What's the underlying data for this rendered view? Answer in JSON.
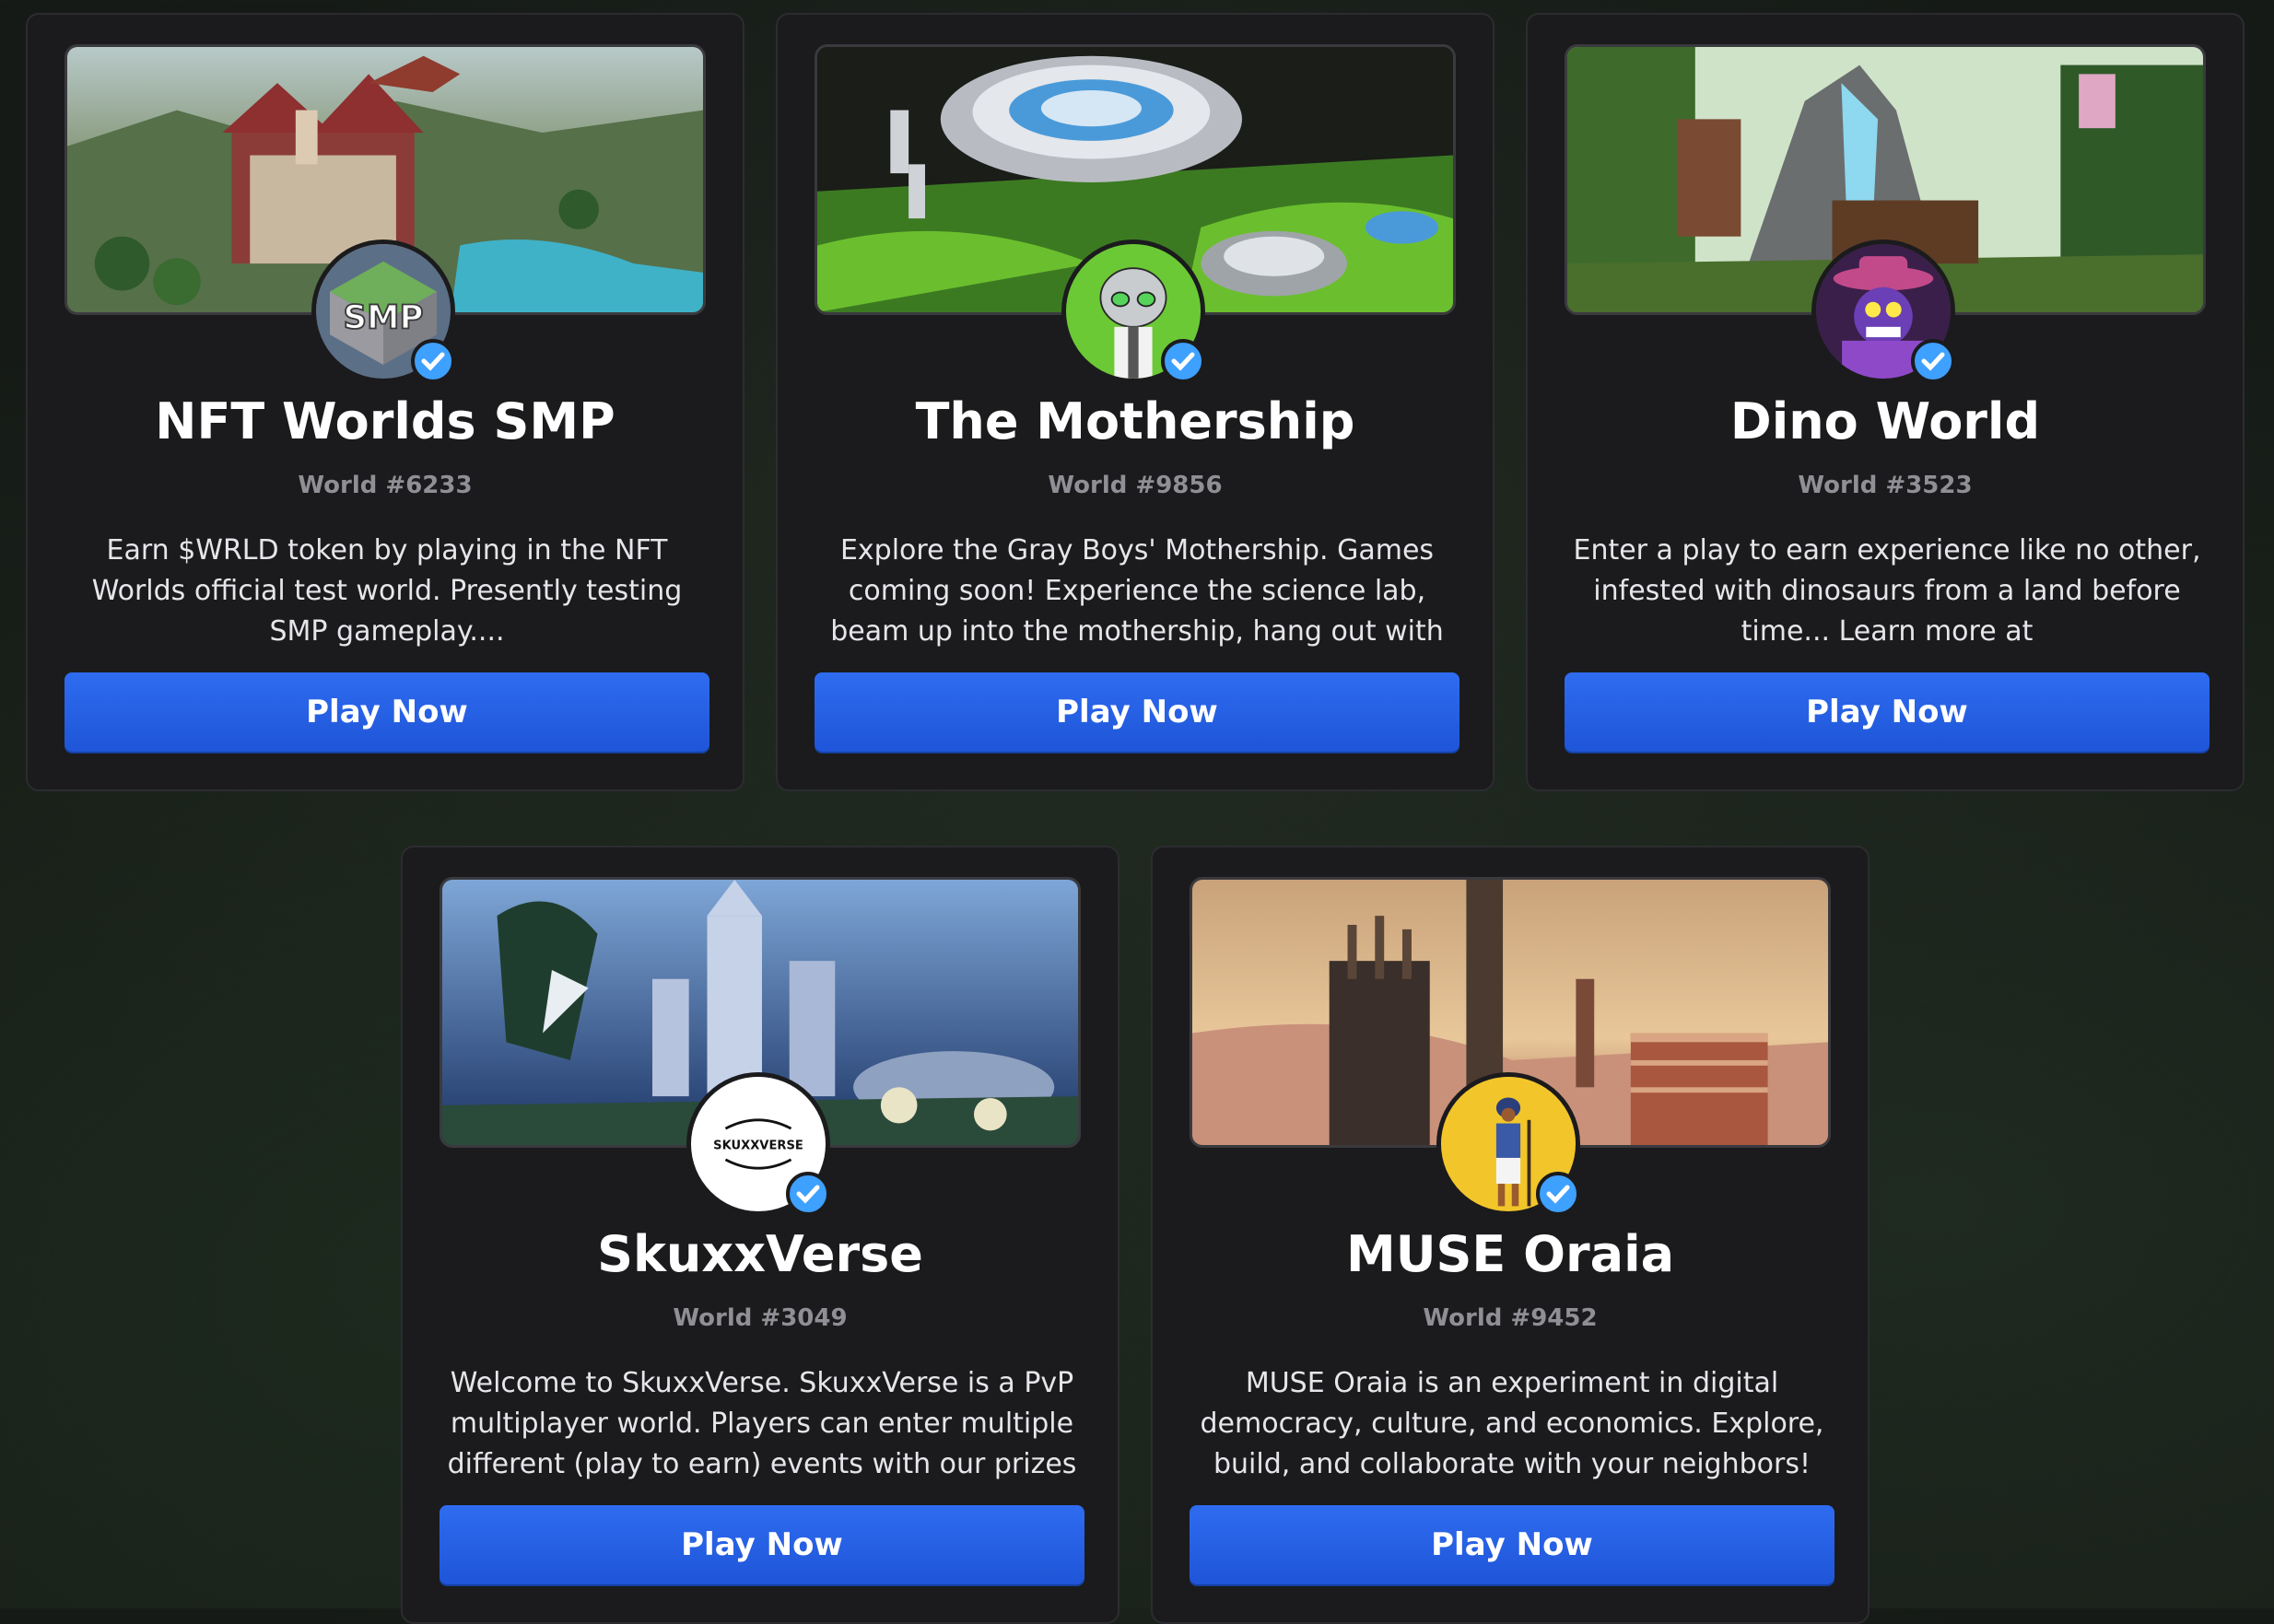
{
  "colors": {
    "card_bg": "#1b1b1d",
    "button_bg": "#2563eb",
    "button_text": "#ffffff",
    "title_text": "#ffffff",
    "subtitle_text": "#8f8f95",
    "verified_badge": "#3ea0ff"
  },
  "cards": [
    {
      "title": "NFT Worlds SMP",
      "world_id": "World #6233",
      "description": "Earn $WRLD token by playing in the NFT Worlds official test world. Presently testing SMP gameplay....",
      "button_label": "Play Now",
      "avatar_text": "SMP",
      "verified": true
    },
    {
      "title": "The Mothership",
      "world_id": "World #9856",
      "description": "Explore the Gray Boys' Mothership. Games coming soon! Experience the science lab, beam up into the mothership, hang out with the ...",
      "button_label": "Play Now",
      "avatar_text": "",
      "verified": true
    },
    {
      "title": "Dino World",
      "world_id": "World #3523",
      "description": "Enter a play to earn experience like no other, infested with dinosaurs from a land before time... Learn more at discord.gg/badbabydinos",
      "button_label": "Play Now",
      "avatar_text": "",
      "verified": true
    },
    {
      "title": "SkuxxVerse",
      "world_id": "World #3049",
      "description": "Welcome to SkuxxVerse. SkuxxVerse is a PvP multiplayer world. Players can enter multiple different (play to earn) events with our prizes ...",
      "button_label": "Play Now",
      "avatar_text": "SKUXXVERSE",
      "verified": true
    },
    {
      "title": "MUSE Oraia",
      "world_id": "World #9452",
      "description": "MUSE Oraia is an experiment in digital democracy, culture, and economics. Explore, build, and collaborate with your neighbors!",
      "button_label": "Play Now",
      "avatar_text": "",
      "verified": true
    }
  ]
}
